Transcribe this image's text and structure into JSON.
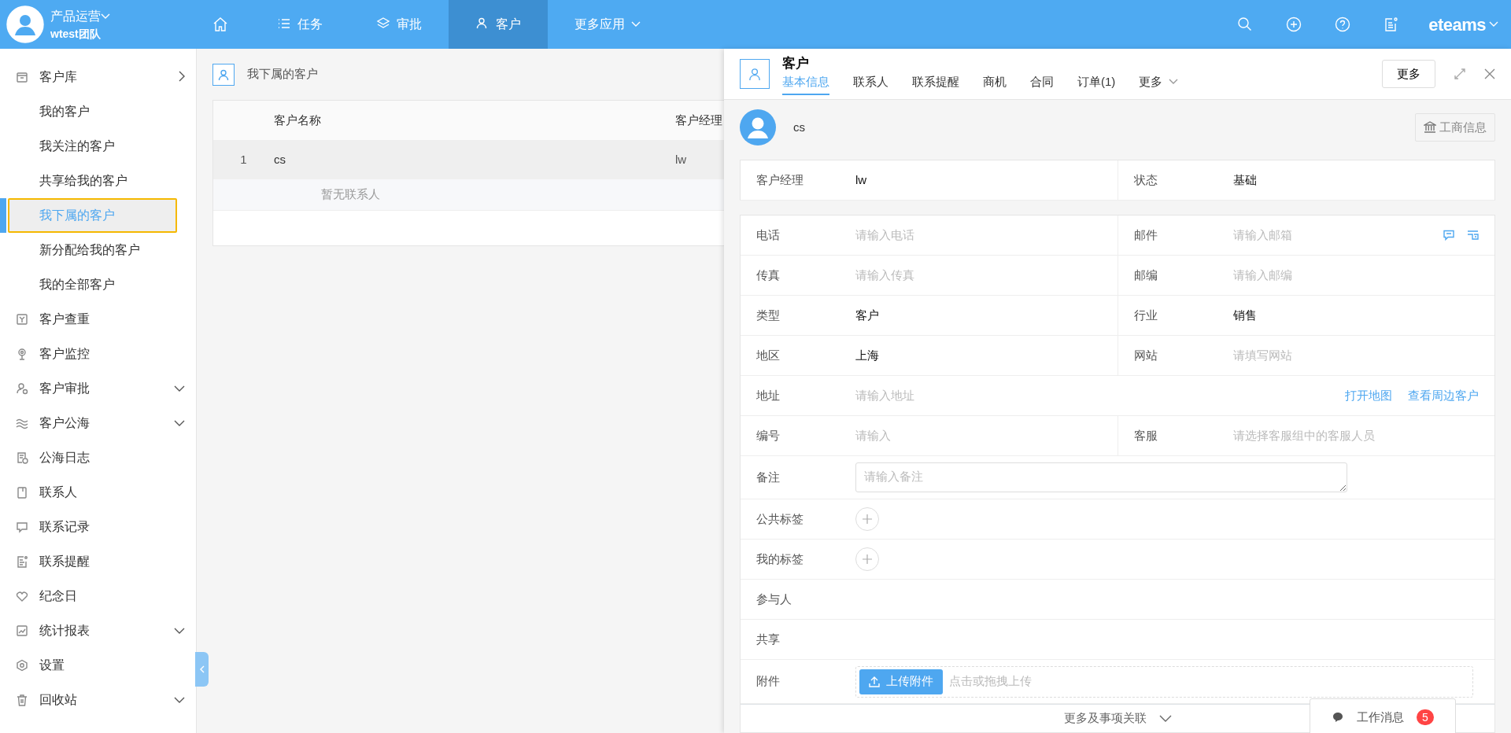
{
  "top_bar": {
    "user": {
      "name": "产品运营",
      "team": "wtest团队"
    },
    "nav": [
      {
        "kind": "home",
        "selected": false
      },
      {
        "kind": "list",
        "label": "任务",
        "selected": false
      },
      {
        "kind": "layers",
        "label": "审批",
        "selected": false
      },
      {
        "kind": "person",
        "label": "客户",
        "selected": true
      },
      {
        "kind": "dropdown",
        "label": "更多应用",
        "selected": false
      }
    ],
    "brand": "eteams"
  },
  "sidebar": {
    "items": [
      {
        "label": "客户库",
        "kind": "flyout",
        "selected": false,
        "children": [
          {
            "label": "我的客户",
            "selected": false
          },
          {
            "label": "我关注的客户",
            "selected": false
          },
          {
            "label": "共享给我的客户",
            "selected": false
          },
          {
            "label": "我下属的客户",
            "selected": true
          },
          {
            "label": "新分配给我的客户",
            "selected": false
          },
          {
            "label": "我的全部客户",
            "selected": false
          }
        ]
      },
      {
        "label": "客户查重",
        "selected": false
      },
      {
        "label": "客户监控",
        "selected": false
      },
      {
        "label": "客户审批",
        "kind": "collapsible",
        "selected": false
      },
      {
        "label": "客户公海",
        "kind": "collapsible",
        "selected": false
      },
      {
        "label": "公海日志",
        "selected": false
      },
      {
        "label": "联系人",
        "selected": false
      },
      {
        "label": "联系记录",
        "selected": false
      },
      {
        "label": "联系提醒",
        "selected": false
      },
      {
        "label": "纪念日",
        "selected": false
      },
      {
        "label": "统计报表",
        "kind": "collapsible",
        "selected": false
      },
      {
        "label": "设置",
        "selected": false
      },
      {
        "label": "回收站",
        "kind": "collapsible",
        "selected": false
      }
    ]
  },
  "list_panel": {
    "title": "我下属的客户",
    "table": {
      "columns": [
        "客户名称",
        "客户经理"
      ],
      "rows": [
        {
          "index": "1",
          "name": "cs",
          "manager": "lw",
          "contacts_note": "暂无联系人",
          "selected": true
        }
      ]
    }
  },
  "detail": {
    "title": "客户",
    "tabs": [
      {
        "label": "基本信息",
        "selected": true
      },
      {
        "label": "联系人",
        "selected": false
      },
      {
        "label": "联系提醒",
        "selected": false
      },
      {
        "label": "商机",
        "selected": false
      },
      {
        "label": "合同",
        "selected": false
      },
      {
        "label": "订单(1)",
        "selected": false
      },
      {
        "label": "更多",
        "kind": "dropdown",
        "selected": false
      }
    ],
    "more_button": "更多",
    "customer_name": "cs",
    "business_info_button": "工商信息",
    "summary": [
      {
        "label": "客户经理",
        "value": "lw"
      },
      {
        "label": "状态",
        "value": "基础"
      }
    ],
    "form": [
      {
        "kind": "pair",
        "fields": [
          {
            "label": "电话",
            "placeholder": "请输入电话"
          },
          {
            "label": "邮件",
            "placeholder": "请输入邮箱",
            "kind": "contact"
          }
        ]
      },
      {
        "kind": "pair",
        "fields": [
          {
            "label": "传真",
            "placeholder": "请输入传真"
          },
          {
            "label": "邮编",
            "placeholder": "请输入邮编"
          }
        ]
      },
      {
        "kind": "pair",
        "fields": [
          {
            "label": "类型",
            "value": "客户"
          },
          {
            "label": "行业",
            "value": "销售"
          }
        ]
      },
      {
        "kind": "pair",
        "fields": [
          {
            "label": "地区",
            "value": "上海"
          },
          {
            "label": "网站",
            "placeholder": "请填写网站"
          }
        ]
      },
      {
        "kind": "address",
        "label": "地址",
        "placeholder": "请输入地址",
        "links": [
          "打开地图",
          "查看周边客户"
        ]
      },
      {
        "kind": "pair",
        "fields": [
          {
            "label": "编号",
            "placeholder": "请输入"
          },
          {
            "label": "客服",
            "placeholder": "请选择客服组中的客服人员"
          }
        ]
      },
      {
        "kind": "textarea",
        "label": "备注",
        "placeholder": "请输入备注"
      },
      {
        "kind": "tags",
        "label": "公共标签"
      },
      {
        "kind": "tags",
        "label": "我的标签"
      },
      {
        "kind": "plain",
        "label": "参与人"
      },
      {
        "kind": "plain",
        "label": "共享"
      },
      {
        "kind": "upload",
        "label": "附件",
        "button": "上传附件",
        "hint": "点击或拖拽上传"
      }
    ],
    "footer": "更多及事项关联"
  },
  "messages": {
    "label": "工作消息",
    "count": "5"
  }
}
